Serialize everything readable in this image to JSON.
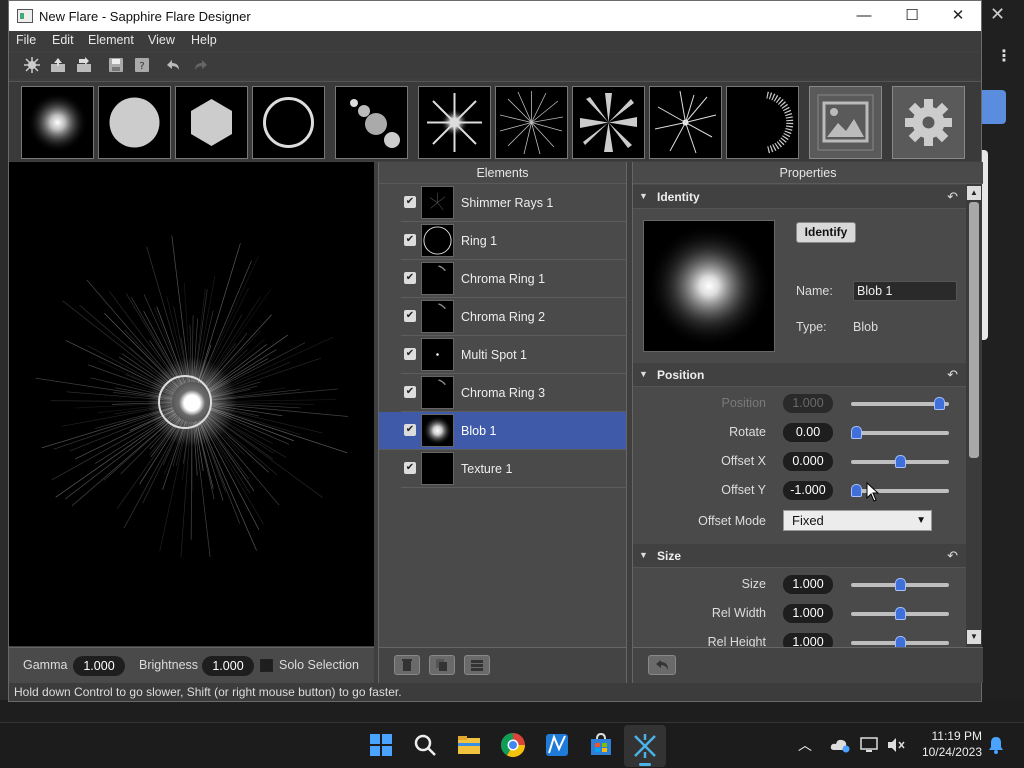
{
  "window": {
    "title": "New Flare - Sapphire Flare Designer",
    "minimize_glyph": "—",
    "maximize_glyph": "☐",
    "close_glyph": "✕"
  },
  "menu": [
    "File",
    "Edit",
    "Element",
    "View",
    "Help"
  ],
  "toolbar_icons": [
    "new-flare-icon",
    "export-icon",
    "import-icon",
    "save-icon",
    "save-as-icon",
    "undo-icon",
    "redo-icon"
  ],
  "presets": [
    {
      "name": "glow-preset"
    },
    {
      "name": "blob-preset"
    },
    {
      "name": "hexagon-preset"
    },
    {
      "name": "ring-preset"
    },
    {
      "name": "multi-spot-preset"
    },
    {
      "name": "star-preset"
    },
    {
      "name": "shimmer-rays-preset"
    },
    {
      "name": "spikes-preset"
    },
    {
      "name": "streak-rays-preset"
    },
    {
      "name": "chroma-ring-preset"
    },
    {
      "name": "texture-preset"
    },
    {
      "name": "settings-preset"
    }
  ],
  "preview": {
    "gamma_label": "Gamma",
    "gamma_value": "1.000",
    "brightness_label": "Brightness",
    "brightness_value": "1.000",
    "solo_label": "Solo Selection"
  },
  "elements_panel": {
    "header": "Elements",
    "items": [
      {
        "label": "Shimmer Rays 1",
        "checked": true,
        "selected": false
      },
      {
        "label": "Ring 1",
        "checked": true,
        "selected": false
      },
      {
        "label": "Chroma Ring 1",
        "checked": true,
        "selected": false
      },
      {
        "label": "Chroma Ring 2",
        "checked": true,
        "selected": false
      },
      {
        "label": "Multi Spot 1",
        "checked": true,
        "selected": false
      },
      {
        "label": "Chroma Ring 3",
        "checked": true,
        "selected": false
      },
      {
        "label": "Blob 1",
        "checked": true,
        "selected": true
      },
      {
        "label": "Texture 1",
        "checked": true,
        "selected": false
      }
    ]
  },
  "properties_panel": {
    "header": "Properties",
    "identity": {
      "title": "Identity",
      "identify_button": "Identify",
      "name_label": "Name:",
      "name_value": "Blob 1",
      "type_label": "Type:",
      "type_value": "Blob"
    },
    "position": {
      "title": "Position",
      "rows": [
        {
          "label": "Position",
          "value": "1.000",
          "slider": 0.95,
          "disabled": true
        },
        {
          "label": "Rotate",
          "value": "0.00",
          "slider": 0.0,
          "disabled": false
        },
        {
          "label": "Offset X",
          "value": "0.000",
          "slider": 0.5,
          "disabled": false
        },
        {
          "label": "Offset Y",
          "value": "-1.000",
          "slider": 0.0,
          "disabled": false
        }
      ],
      "offset_mode_label": "Offset Mode",
      "offset_mode_value": "Fixed"
    },
    "size": {
      "title": "Size",
      "rows": [
        {
          "label": "Size",
          "value": "1.000",
          "slider": 0.5
        },
        {
          "label": "Rel Width",
          "value": "1.000",
          "slider": 0.5
        },
        {
          "label": "Rel Height",
          "value": "1.000",
          "slider": 0.5
        }
      ]
    }
  },
  "status": "Hold down Control to go slower, Shift (or right mouse button) to go faster.",
  "taskbar": {
    "apps": [
      "windows-start-icon",
      "search-icon",
      "file-explorer-icon",
      "chrome-icon",
      "sapphire-icon",
      "store-icon",
      "flare-designer-icon"
    ],
    "time": "11:19 PM",
    "date": "10/24/2023"
  },
  "colors": {
    "selection": "#3f5aa8",
    "slider_knob": "#3f6fd8",
    "panel_bg": "#4a4a4a"
  }
}
